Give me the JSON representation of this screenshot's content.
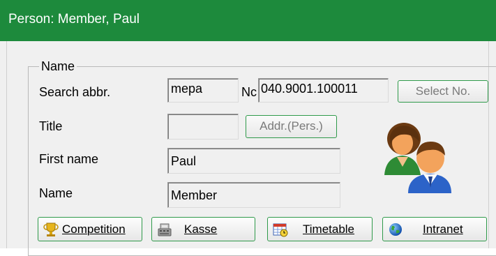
{
  "window": {
    "title": "Person: Member, Paul"
  },
  "group": {
    "legend": "Name"
  },
  "fields": {
    "search_abbr": {
      "label": "Search abbr.",
      "value": "mepa"
    },
    "number": {
      "label": "Nc",
      "value": "040.9001.100011"
    },
    "title": {
      "label": "Title",
      "value": ""
    },
    "first_name": {
      "label": "First name",
      "value": "Paul"
    },
    "name": {
      "label": "Name",
      "value": "Member"
    }
  },
  "buttons": {
    "select_no": "Select No.",
    "addr_pers": "Addr.(Pers.)",
    "competition": "Competition",
    "kasse": "Kasse",
    "timetable": "Timetable",
    "intranet": "Intranet"
  },
  "icons": {
    "persons": "persons-icon",
    "trophy": "trophy-icon",
    "cash": "cash-register-icon",
    "timetable": "calendar-icon",
    "globe": "globe-icon"
  },
  "colors": {
    "titlebar": "#1d8a3c",
    "button_border": "#2f9a4a"
  }
}
